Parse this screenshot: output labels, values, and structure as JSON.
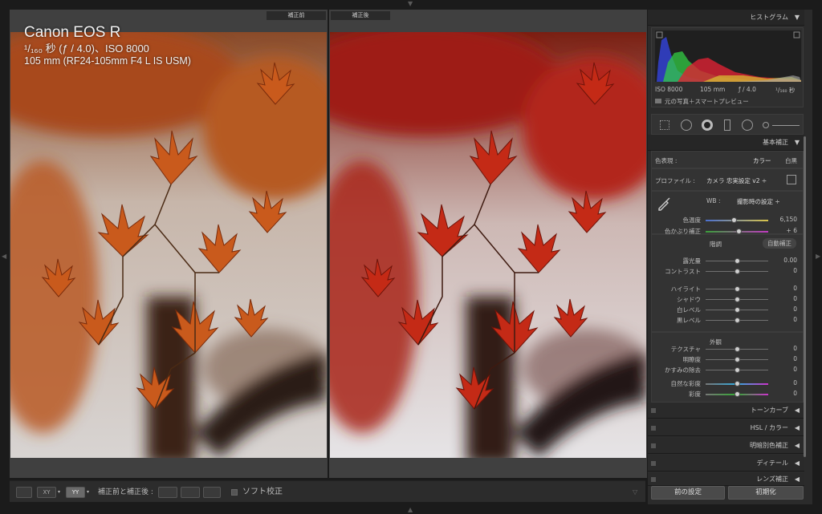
{
  "preview": {
    "before_label": "補正前",
    "after_label": "補正後",
    "camera": "Canon EOS R",
    "exposure": "¹/₁₆₀ 秒 (ƒ / 4.0)、ISO 8000",
    "lens": "105 mm (RF24-105mm F4 L IS USM)"
  },
  "toolbar": {
    "compare_label": "補正前と補正後 :",
    "soft_proof_label": "ソフト校正"
  },
  "histogram": {
    "title": "ヒストグラム",
    "iso": "ISO 8000",
    "focal": "105 mm",
    "aperture": "ƒ / 4.0",
    "shutter": "¹/₁₆₀ 秒",
    "preview_mode": "元の写真＋スマートプレビュー"
  },
  "basic": {
    "title": "基本補正",
    "treatment_label": "色表現 :",
    "treatment_color": "カラー",
    "treatment_bw": "白黒",
    "profile_label": "プロファイル :",
    "profile_value": "カメラ 忠実設定 v2 ÷",
    "wb_label": "WB :",
    "wb_value": "撮影時の設定 ÷",
    "tone_label": "階調",
    "auto_label": "自動補正",
    "presence_label": "外観",
    "sliders": [
      {
        "label": "色温度",
        "value": "6,150",
        "pos": 0.45
      },
      {
        "label": "色かぶり補正",
        "value": "+ 6",
        "pos": 0.53
      },
      {
        "label": "露光量",
        "value": "0.00",
        "pos": 0.5
      },
      {
        "label": "コントラスト",
        "value": "0",
        "pos": 0.5
      },
      {
        "label": "ハイライト",
        "value": "0",
        "pos": 0.5
      },
      {
        "label": "シャドウ",
        "value": "0",
        "pos": 0.5
      },
      {
        "label": "白レベル",
        "value": "0",
        "pos": 0.5
      },
      {
        "label": "黒レベル",
        "value": "0",
        "pos": 0.5
      },
      {
        "label": "テクスチャ",
        "value": "0",
        "pos": 0.5
      },
      {
        "label": "明瞭度",
        "value": "0",
        "pos": 0.5
      },
      {
        "label": "かすみの除去",
        "value": "0",
        "pos": 0.5
      },
      {
        "label": "自然な彩度",
        "value": "0",
        "pos": 0.5
      },
      {
        "label": "彩度",
        "value": "0",
        "pos": 0.5
      }
    ]
  },
  "panels": {
    "tone_curve": "トーンカーブ",
    "hsl": "HSL / カラー",
    "split": "明暗別色補正",
    "detail": "ディテール",
    "lens": "レンズ補正"
  },
  "buttons": {
    "previous": "前の設定",
    "reset": "初期化"
  }
}
